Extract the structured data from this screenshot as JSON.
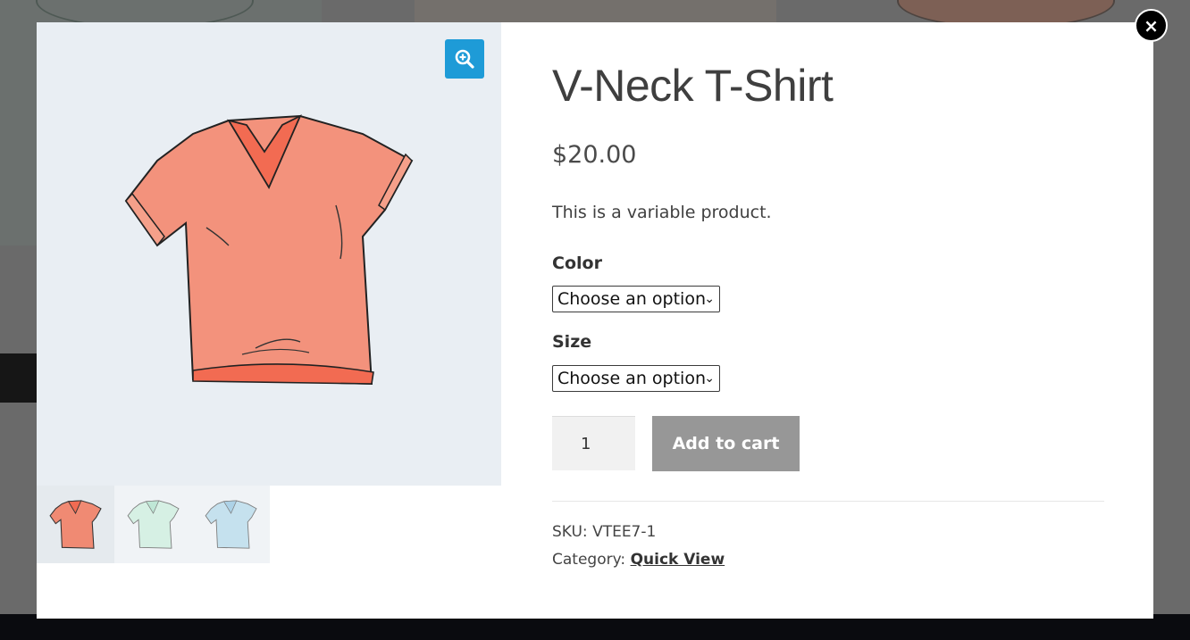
{
  "product": {
    "title": "V-Neck T-Shirt",
    "price": "$20.00",
    "description": "This is a variable product."
  },
  "variations": {
    "color_label": "Color",
    "color_value": "Choose an option",
    "size_label": "Size",
    "size_value": "Choose an option"
  },
  "cart": {
    "quantity": "1",
    "add_label": "Add to cart"
  },
  "meta": {
    "sku_label": "SKU:",
    "sku_value": "VTEE7-1",
    "category_label": "Category:",
    "category_value": "Quick View"
  },
  "gallery": {
    "thumbnails": [
      "coral-shirt",
      "mint-shirt",
      "blue-shirt"
    ],
    "zoom_icon": "zoom-in-icon"
  },
  "colors": {
    "zoom_button": "#1e9bd7",
    "add_button": "#979797",
    "shirt_coral": "#f08a73",
    "shirt_mint": "#cfeee0",
    "shirt_blue": "#bcdcec"
  },
  "close_icon": "×"
}
